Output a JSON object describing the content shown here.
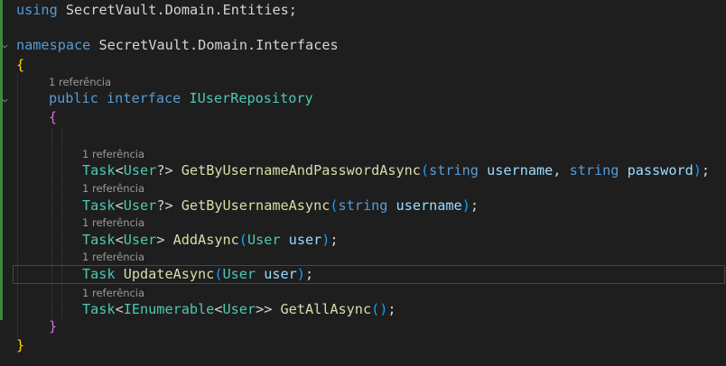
{
  "editor": {
    "lines": {
      "using": {
        "kw": "using",
        "ns": "SecretVault.Domain.Entities",
        "end": ";"
      },
      "namespace": {
        "kw": "namespace",
        "ns": "SecretVault.Domain.Interfaces"
      },
      "open_ns": "{",
      "lens_interface": "1 referência",
      "interface": {
        "kw1": "public",
        "kw2": "interface",
        "name": "IUserRepository"
      },
      "open_iface": "{",
      "lens_m1": "1 referência",
      "m1": {
        "task": "Task",
        "lt": "<",
        "type": "User",
        "q": "?>",
        "name": "GetByUsernameAndPasswordAsync",
        "open": "(",
        "t1": "string",
        "p1": "username",
        "comma": ", ",
        "t2": "string",
        "p2": "password",
        "close": ")",
        "end": ";"
      },
      "lens_m2": "1 referência",
      "m2": {
        "task": "Task",
        "lt": "<",
        "type": "User",
        "q": "?>",
        "name": "GetByUsernameAsync",
        "open": "(",
        "t1": "string",
        "p1": "username",
        "close": ")",
        "end": ";"
      },
      "lens_m3": "1 referência",
      "m3": {
        "task": "Task",
        "lt": "<",
        "type": "User",
        "gt": ">",
        "name": "AddAsync",
        "open": "(",
        "t1": "User",
        "p1": "user",
        "close": ")",
        "end": ";"
      },
      "lens_m4": "1 referência",
      "m4": {
        "task": "Task",
        "name": "UpdateAsync",
        "open": "(",
        "t1": "User",
        "p1": "user",
        "close": ")",
        "end": ";"
      },
      "lens_m5": "1 referência",
      "m5": {
        "task": "Task",
        "lt": "<",
        "enum": "IEnumerable",
        "lt2": "<",
        "type": "User",
        "gt": ">>",
        "name": "GetAllAsync",
        "parens": "()",
        "end": ";"
      },
      "close_iface": "}",
      "close_ns": "}"
    },
    "colors": {
      "keyword": "#569cd6",
      "type": "#4ec9b0",
      "method": "#dcdcaa",
      "param": "#9cdcfe",
      "text": "#d4d4d4",
      "bracket1": "#ffd700",
      "bracket2": "#da70d6",
      "bracket3": "#179fff"
    }
  }
}
